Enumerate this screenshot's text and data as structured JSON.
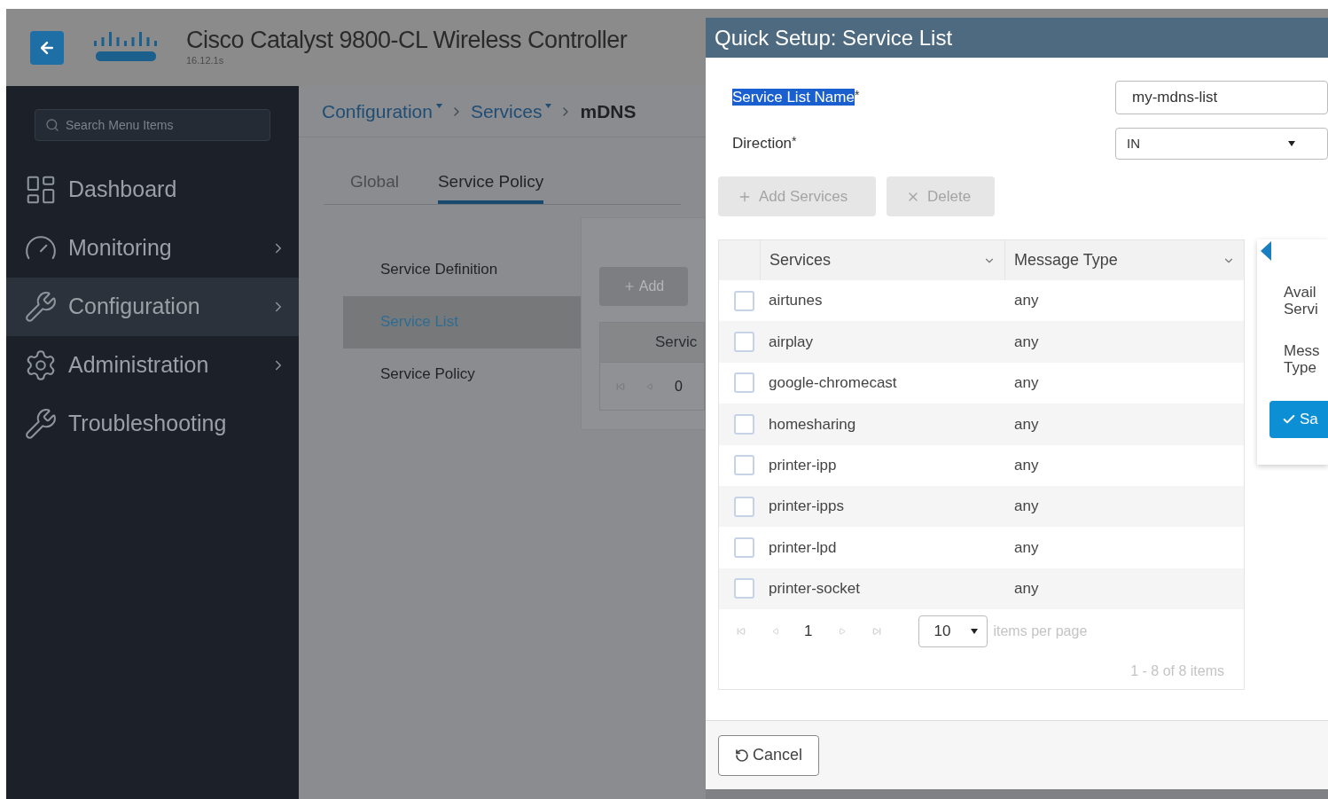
{
  "header": {
    "title": "Cisco Catalyst 9800-CL Wireless Controller",
    "version": "16.12.1s"
  },
  "sidebar": {
    "search_placeholder": "Search Menu Items",
    "items": [
      {
        "kind": "dashboard",
        "label": "Dashboard",
        "selected": false,
        "has_submenu": false
      },
      {
        "kind": "monitoring",
        "label": "Monitoring",
        "selected": false,
        "has_submenu": true
      },
      {
        "kind": "configuration",
        "label": "Configuration",
        "selected": true,
        "has_submenu": true
      },
      {
        "kind": "administration",
        "label": "Administration",
        "selected": false,
        "has_submenu": true
      },
      {
        "kind": "troubleshooting",
        "label": "Troubleshooting",
        "selected": false,
        "has_submenu": false
      }
    ]
  },
  "breadcrumb": [
    {
      "label": "Configuration",
      "dropdown": true
    },
    {
      "label": "Services",
      "dropdown": true
    },
    {
      "label": "mDNS",
      "dropdown": false
    }
  ],
  "tabs": [
    {
      "label": "Global",
      "selected": false
    },
    {
      "label": "Service Policy",
      "selected": true
    }
  ],
  "submenu": [
    {
      "label": "Service Definition",
      "selected": false
    },
    {
      "label": "Service List",
      "selected": true
    },
    {
      "label": "Service Policy",
      "selected": false
    }
  ],
  "background_panel": {
    "add_button": "Add",
    "column": "Servic",
    "page": "0"
  },
  "dialog": {
    "title": "Quick Setup: Service List",
    "fields": [
      {
        "kind": "text",
        "label": "Service List Name",
        "required_mark": "*",
        "label_selected": true,
        "value": "my-mdns-list"
      },
      {
        "kind": "select",
        "label": "Direction",
        "required_mark": "*",
        "label_selected": false,
        "value": "IN"
      }
    ],
    "buttons": [
      {
        "kind": "add",
        "label": "Add Services",
        "disabled": true
      },
      {
        "kind": "delete",
        "label": "Delete",
        "disabled": true
      }
    ],
    "table": {
      "columns": [
        "Services",
        "Message Type"
      ],
      "rows": [
        {
          "service": "airtunes",
          "message_type": "any",
          "checked": false
        },
        {
          "service": "airplay",
          "message_type": "any",
          "checked": false
        },
        {
          "service": "google-chromecast",
          "message_type": "any",
          "checked": false
        },
        {
          "service": "homesharing",
          "message_type": "any",
          "checked": false
        },
        {
          "service": "printer-ipp",
          "message_type": "any",
          "checked": false
        },
        {
          "service": "printer-ipps",
          "message_type": "any",
          "checked": false
        },
        {
          "service": "printer-lpd",
          "message_type": "any",
          "checked": false
        },
        {
          "service": "printer-socket",
          "message_type": "any",
          "checked": false
        }
      ],
      "page": "1",
      "page_size": "10",
      "page_size_label": "items per page",
      "summary": "1 - 8 of 8 items"
    },
    "side_panel": {
      "labels": [
        [
          "Avail",
          "Servi"
        ],
        [
          "Mess",
          "Type"
        ]
      ],
      "save_button": "Sa"
    },
    "cancel_button": "Cancel"
  }
}
